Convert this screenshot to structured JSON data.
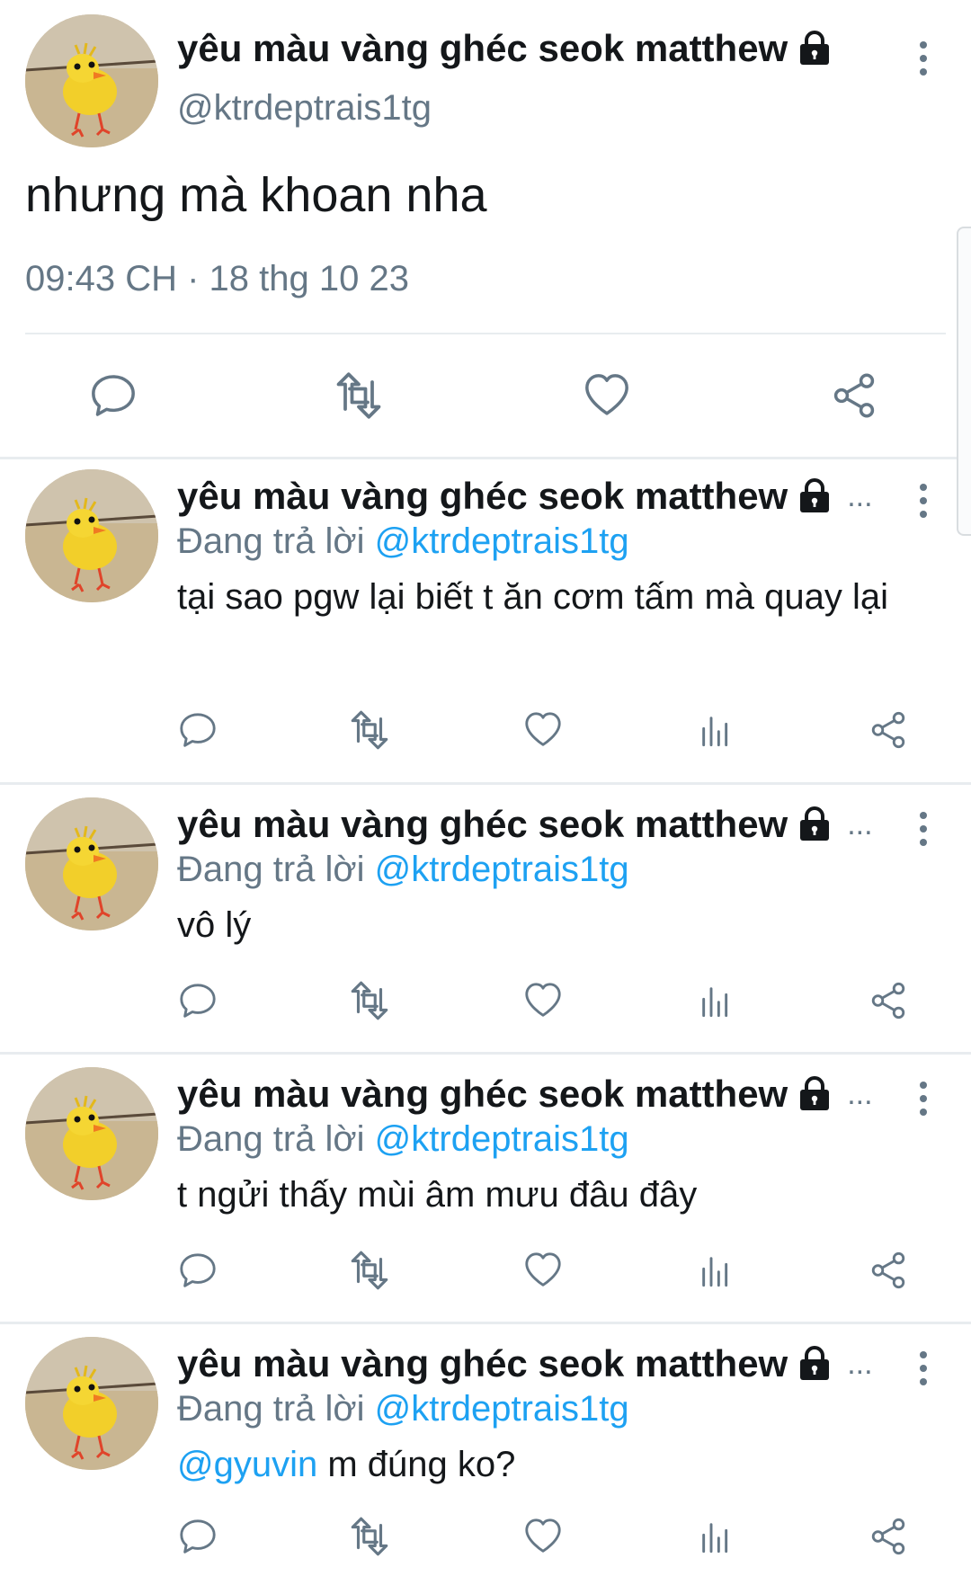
{
  "main_tweet": {
    "author_name": "yêu màu vàng ghéc seok matthew",
    "handle": "@ktrdeptrais1tg",
    "text": "nhưng mà khoan nha",
    "timestamp": "09:43 CH · 18 thg 10 23",
    "protected_icon": "lock-icon",
    "actions": [
      "reply-icon",
      "retweet-icon",
      "like-icon",
      "share-icon"
    ]
  },
  "replies": [
    {
      "author_name": "yêu màu vàng ghéc seok matthew",
      "more": "...",
      "replying_label": "Đang trả lời",
      "replying_to": "@ktrdeptrais1tg",
      "text": "tại sao pgw lại biết t ăn cơm tấm mà quay lại"
    },
    {
      "author_name": "yêu màu vàng ghéc seok matthew",
      "more": "...",
      "replying_label": "Đang trả lời",
      "replying_to": "@ktrdeptrais1tg",
      "text": "vô lý"
    },
    {
      "author_name": "yêu màu vàng ghéc seok matthew",
      "more": "...",
      "replying_label": "Đang trả lời",
      "replying_to": "@ktrdeptrais1tg",
      "text": "t ngửi thấy mùi âm mưu đâu đây"
    },
    {
      "author_name": "yêu màu vàng ghéc seok matthew",
      "more": "...",
      "replying_label": "Đang trả lời",
      "replying_to": "@ktrdeptrais1tg",
      "text_mention": "@gyuvin",
      "text": " m đúng ko?"
    }
  ],
  "colors": {
    "link": "#1da1f2",
    "secondary": "#657786",
    "divider": "#e8ecef"
  }
}
